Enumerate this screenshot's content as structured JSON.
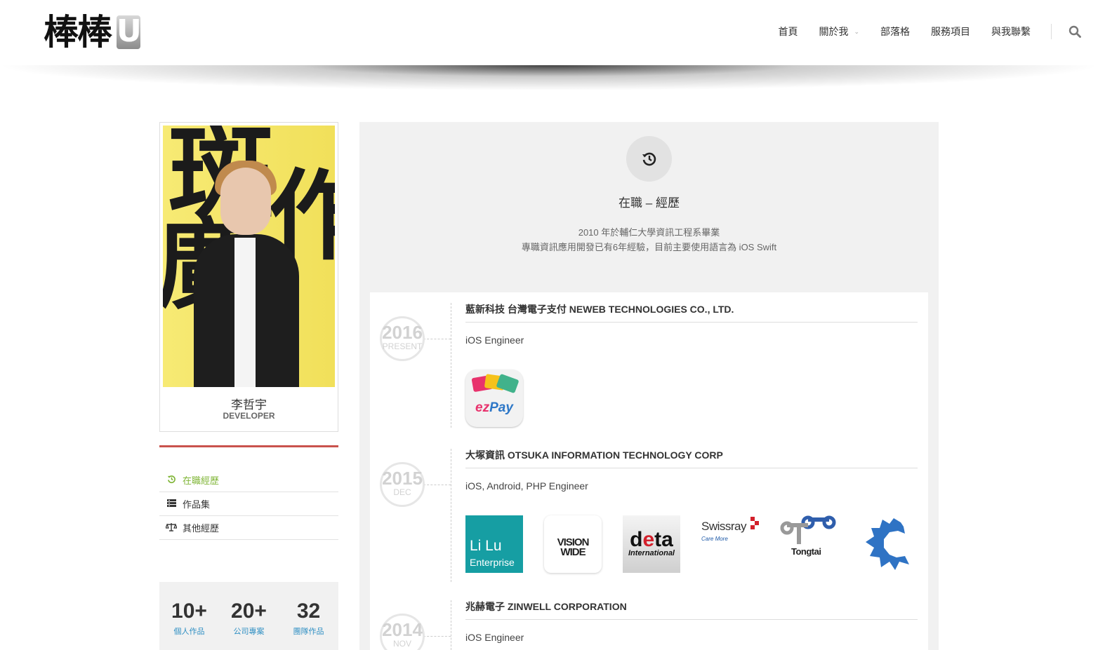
{
  "header": {
    "logo_text": "棒棒",
    "logo_badge": "U",
    "nav": [
      {
        "label": "首頁"
      },
      {
        "label": "關於我",
        "has_dropdown": true
      },
      {
        "label": "部落格"
      },
      {
        "label": "服務項目"
      },
      {
        "label": "與我聯繫"
      }
    ],
    "search_icon": "search-icon"
  },
  "profile": {
    "name": "李哲宇",
    "role": "DEVELOPER"
  },
  "side_menu": [
    {
      "label": "在職經歷",
      "icon": "history-icon",
      "active": true
    },
    {
      "label": "作品集",
      "icon": "portfolio-icon",
      "active": false
    },
    {
      "label": "其他經歷",
      "icon": "balance-icon",
      "active": false
    }
  ],
  "stats": [
    {
      "value": "10+",
      "label": "個人作品"
    },
    {
      "value": "20+",
      "label": "公司專案"
    },
    {
      "value": "32",
      "label": "團隊作品"
    }
  ],
  "main": {
    "title": "在職 – 經歷",
    "intro_line1": "2010 年於輔仁大學資訊工程系畢業",
    "intro_line2": "專職資訊應用開發已有6年經驗，目前主要使用語言為 iOS Swift"
  },
  "timeline": [
    {
      "year": "2016",
      "sub": "PRESENT",
      "company": "藍新科技 台灣電子支付 NEWEB TECHNOLOGIES CO., LTD.",
      "role": "iOS Engineer",
      "logos": [
        "ezPay"
      ]
    },
    {
      "year": "2015",
      "sub": "DEC",
      "company": "大塚資訊 OTSUKA INFORMATION TECHNOLOGY CORP",
      "role": "iOS, Android, PHP Engineer",
      "logos": [
        "Li Lu Enterprise",
        "VISION WIDE",
        "deta International",
        "Swissray Care More",
        "Tongtai",
        "C logo"
      ]
    },
    {
      "year": "2014",
      "sub": "NOV",
      "company": "兆赫電子 ZINWELL CORPORATION",
      "role": "iOS Engineer",
      "logos": []
    }
  ],
  "logo_text": {
    "ezpay_ez": "ez",
    "ezpay_pay": "Pay",
    "lilu_1": "Li Lu",
    "lilu_2": "Enterprise",
    "vision_1": "VISION",
    "vision_2": "WIDE",
    "deta_d": "d",
    "deta_e": "e",
    "deta_ta": "ta",
    "deta_2": "International",
    "swiss_1": "Swissray",
    "swiss_2": "Care More",
    "tongtai": "Tongtai"
  },
  "colors": {
    "accent_green": "#7fb536",
    "accent_red": "#c9524d",
    "stat_label_blue": "#2f8fc3",
    "panel_bg": "#f1f1f1"
  }
}
